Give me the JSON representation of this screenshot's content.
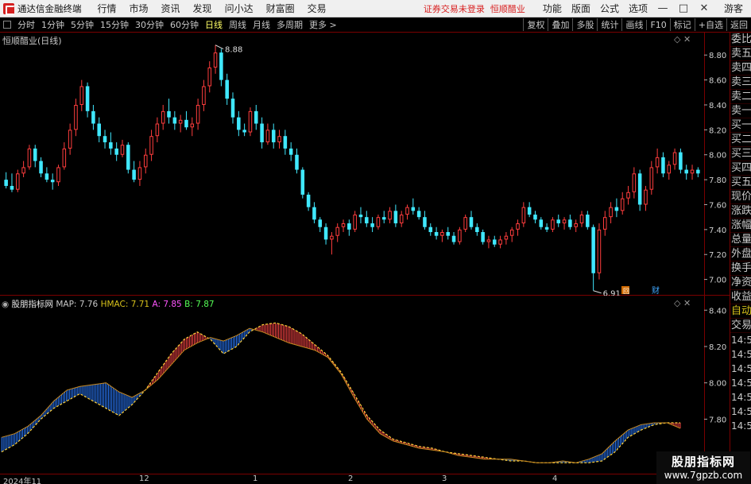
{
  "window": {
    "app_title": "通达信金融终端",
    "menu": [
      "行情",
      "市场",
      "资讯",
      "发现",
      "问小达",
      "财富圈",
      "交易"
    ],
    "notice": "证券交易未登录",
    "stock_name": "恒顺醋业",
    "right_menu": [
      "功能",
      "版面",
      "公式",
      "选项"
    ],
    "guest": "游客"
  },
  "toolbar": {
    "periods": [
      "分时",
      "1分钟",
      "5分钟",
      "15分钟",
      "30分钟",
      "60分钟",
      "日线",
      "周线",
      "月线",
      "多周期",
      "更多 >"
    ],
    "active_period": "日线",
    "tools": [
      "复权",
      "叠加",
      "多股",
      "统计",
      "画线",
      "F10",
      "标记",
      "+自选",
      "返回"
    ]
  },
  "main_panel": {
    "label": "恒顺醋业(日线)",
    "controls": "◇ ✕",
    "high_label": "8.88",
    "low_label": "6.91",
    "icon_a": "回",
    "icon_b": "财"
  },
  "indicator_panel": {
    "name": "股朋指标网",
    "map_label": "MAP:",
    "map_value": "7.76",
    "hmac_label": "HMAC:",
    "hmac_value": "7.71",
    "a_label": "A:",
    "a_value": "7.85",
    "b_label": "B:",
    "b_value": "7.87",
    "controls": "◇ ✕"
  },
  "side_panel": {
    "rows": [
      "委比",
      "卖五",
      "卖四",
      "卖三",
      "卖二",
      "卖一",
      "买一",
      "买二",
      "买三",
      "买四",
      "买五",
      "现价",
      "涨跌",
      "涨幅",
      "总量",
      "外盘",
      "换手",
      "净资",
      "收益"
    ],
    "auto_label": "自动",
    "trade_label": "交易",
    "times": [
      "14:56",
      "14:56",
      "14:56",
      "14:56",
      "14:56",
      "14:56",
      "14:56"
    ],
    "top_marker": "8"
  },
  "date_axis": {
    "labels": [
      "2024年11",
      "12",
      "1",
      "2",
      "3",
      "4"
    ]
  },
  "watermark": {
    "line1": "股朋指标网",
    "line2": "www.7gpzb.com"
  },
  "colors": {
    "up": "#ff3d3d",
    "down": "#40e8ff",
    "grid": "#7a0000",
    "axis_text": "#d0d0d0",
    "ribbon_red": "#ff4646",
    "ribbon_blue": "#2b7bff",
    "ribbon_line": "#ffd13a"
  },
  "chart_data": [
    {
      "type": "candlestick",
      "title": "恒顺醋业(日线)",
      "y_ticks": [
        7.0,
        7.2,
        7.4,
        7.6,
        7.8,
        8.0,
        8.2,
        8.4,
        8.6,
        8.8
      ],
      "ylim": [
        6.87,
        8.98
      ],
      "annotations": [
        {
          "text": "8.88",
          "value": 8.88
        },
        {
          "text": "6.91",
          "value": 6.91
        }
      ],
      "candles": [
        [
          7.8,
          7.86,
          7.73,
          7.75
        ],
        [
          7.75,
          7.85,
          7.7,
          7.72
        ],
        [
          7.72,
          7.88,
          7.7,
          7.85
        ],
        [
          7.85,
          7.95,
          7.82,
          7.9
        ],
        [
          7.9,
          8.08,
          7.88,
          8.05
        ],
        [
          8.05,
          8.08,
          7.9,
          7.95
        ],
        [
          7.95,
          7.98,
          7.82,
          7.85
        ],
        [
          7.85,
          7.9,
          7.78,
          7.8
        ],
        [
          7.8,
          7.85,
          7.72,
          7.78
        ],
        [
          7.78,
          7.92,
          7.75,
          7.9
        ],
        [
          7.9,
          8.1,
          7.88,
          8.05
        ],
        [
          8.05,
          8.25,
          8.0,
          8.2
        ],
        [
          8.2,
          8.45,
          8.15,
          8.4
        ],
        [
          8.4,
          8.6,
          8.35,
          8.55
        ],
        [
          8.55,
          8.58,
          8.3,
          8.35
        ],
        [
          8.35,
          8.4,
          8.2,
          8.25
        ],
        [
          8.25,
          8.3,
          8.1,
          8.15
        ],
        [
          8.15,
          8.2,
          8.05,
          8.1
        ],
        [
          8.1,
          8.18,
          8.0,
          8.05
        ],
        [
          8.05,
          8.1,
          7.95,
          8.0
        ],
        [
          8.0,
          8.12,
          7.98,
          8.08
        ],
        [
          8.08,
          8.1,
          7.85,
          7.88
        ],
        [
          7.88,
          7.95,
          7.78,
          7.8
        ],
        [
          7.8,
          7.95,
          7.75,
          7.9
        ],
        [
          7.9,
          8.05,
          7.85,
          8.0
        ],
        [
          8.0,
          8.2,
          7.95,
          8.15
        ],
        [
          8.15,
          8.3,
          8.1,
          8.25
        ],
        [
          8.25,
          8.4,
          8.2,
          8.35
        ],
        [
          8.35,
          8.45,
          8.25,
          8.3
        ],
        [
          8.3,
          8.35,
          8.2,
          8.25
        ],
        [
          8.25,
          8.32,
          8.18,
          8.28
        ],
        [
          8.28,
          8.35,
          8.2,
          8.22
        ],
        [
          8.22,
          8.3,
          8.15,
          8.25
        ],
        [
          8.25,
          8.45,
          8.2,
          8.4
        ],
        [
          8.4,
          8.6,
          8.35,
          8.55
        ],
        [
          8.55,
          8.75,
          8.5,
          8.7
        ],
        [
          8.7,
          8.88,
          8.65,
          8.82
        ],
        [
          8.82,
          8.85,
          8.55,
          8.6
        ],
        [
          8.6,
          8.65,
          8.4,
          8.45
        ],
        [
          8.45,
          8.5,
          8.25,
          8.3
        ],
        [
          8.3,
          8.35,
          8.15,
          8.2
        ],
        [
          8.2,
          8.25,
          8.15,
          8.18
        ],
        [
          8.18,
          8.38,
          8.15,
          8.35
        ],
        [
          8.35,
          8.4,
          8.2,
          8.25
        ],
        [
          8.25,
          8.3,
          8.05,
          8.1
        ],
        [
          8.1,
          8.25,
          8.08,
          8.2
        ],
        [
          8.2,
          8.25,
          8.05,
          8.1
        ],
        [
          8.1,
          8.2,
          8.05,
          8.15
        ],
        [
          8.15,
          8.2,
          8.0,
          8.05
        ],
        [
          8.05,
          8.1,
          7.95,
          8.0
        ],
        [
          8.0,
          8.05,
          7.85,
          7.88
        ],
        [
          7.88,
          7.9,
          7.65,
          7.68
        ],
        [
          7.68,
          7.7,
          7.55,
          7.58
        ],
        [
          7.58,
          7.62,
          7.45,
          7.48
        ],
        [
          7.48,
          7.5,
          7.38,
          7.42
        ],
        [
          7.42,
          7.45,
          7.28,
          7.32
        ],
        [
          7.32,
          7.38,
          7.2,
          7.35
        ],
        [
          7.35,
          7.45,
          7.3,
          7.42
        ],
        [
          7.42,
          7.48,
          7.38,
          7.45
        ],
        [
          7.45,
          7.48,
          7.35,
          7.4
        ],
        [
          7.4,
          7.55,
          7.38,
          7.52
        ],
        [
          7.52,
          7.58,
          7.45,
          7.5
        ],
        [
          7.5,
          7.55,
          7.42,
          7.45
        ],
        [
          7.45,
          7.5,
          7.38,
          7.42
        ],
        [
          7.42,
          7.52,
          7.4,
          7.5
        ],
        [
          7.5,
          7.55,
          7.45,
          7.48
        ],
        [
          7.48,
          7.58,
          7.45,
          7.55
        ],
        [
          7.55,
          7.6,
          7.42,
          7.45
        ],
        [
          7.45,
          7.55,
          7.42,
          7.52
        ],
        [
          7.52,
          7.6,
          7.48,
          7.58
        ],
        [
          7.58,
          7.65,
          7.52,
          7.55
        ],
        [
          7.55,
          7.58,
          7.48,
          7.5
        ],
        [
          7.5,
          7.55,
          7.4,
          7.42
        ],
        [
          7.42,
          7.45,
          7.35,
          7.38
        ],
        [
          7.38,
          7.42,
          7.32,
          7.35
        ],
        [
          7.35,
          7.4,
          7.3,
          7.38
        ],
        [
          7.38,
          7.42,
          7.32,
          7.35
        ],
        [
          7.35,
          7.38,
          7.28,
          7.3
        ],
        [
          7.3,
          7.42,
          7.28,
          7.4
        ],
        [
          7.4,
          7.52,
          7.38,
          7.5
        ],
        [
          7.5,
          7.55,
          7.4,
          7.42
        ],
        [
          7.42,
          7.45,
          7.35,
          7.38
        ],
        [
          7.38,
          7.4,
          7.28,
          7.3
        ],
        [
          7.3,
          7.35,
          7.25,
          7.32
        ],
        [
          7.32,
          7.35,
          7.26,
          7.28
        ],
        [
          7.28,
          7.35,
          7.25,
          7.32
        ],
        [
          7.32,
          7.38,
          7.28,
          7.35
        ],
        [
          7.35,
          7.42,
          7.3,
          7.4
        ],
        [
          7.4,
          7.48,
          7.35,
          7.45
        ],
        [
          7.45,
          7.62,
          7.42,
          7.58
        ],
        [
          7.58,
          7.62,
          7.5,
          7.52
        ],
        [
          7.52,
          7.55,
          7.45,
          7.48
        ],
        [
          7.48,
          7.5,
          7.4,
          7.42
        ],
        [
          7.42,
          7.45,
          7.38,
          7.4
        ],
        [
          7.4,
          7.5,
          7.38,
          7.48
        ],
        [
          7.48,
          7.52,
          7.42,
          7.45
        ],
        [
          7.45,
          7.5,
          7.4,
          7.48
        ],
        [
          7.48,
          7.52,
          7.4,
          7.42
        ],
        [
          7.42,
          7.48,
          7.38,
          7.45
        ],
        [
          7.45,
          7.55,
          7.42,
          7.52
        ],
        [
          7.52,
          7.55,
          7.4,
          7.42
        ],
        [
          7.42,
          7.44,
          6.91,
          7.05
        ],
        [
          7.05,
          7.45,
          7.0,
          7.4
        ],
        [
          7.4,
          7.55,
          7.35,
          7.5
        ],
        [
          7.5,
          7.62,
          7.45,
          7.58
        ],
        [
          7.58,
          7.65,
          7.5,
          7.55
        ],
        [
          7.55,
          7.7,
          7.52,
          7.65
        ],
        [
          7.65,
          7.75,
          7.6,
          7.7
        ],
        [
          7.7,
          7.9,
          7.65,
          7.85
        ],
        [
          7.85,
          7.88,
          7.55,
          7.6
        ],
        [
          7.6,
          7.75,
          7.55,
          7.72
        ],
        [
          7.72,
          7.95,
          7.68,
          7.9
        ],
        [
          7.9,
          8.05,
          7.85,
          7.98
        ],
        [
          7.98,
          8.02,
          7.82,
          7.85
        ],
        [
          7.85,
          7.95,
          7.8,
          7.92
        ],
        [
          7.92,
          8.05,
          7.88,
          8.02
        ],
        [
          8.02,
          8.05,
          7.85,
          7.88
        ],
        [
          7.88,
          7.92,
          7.8,
          7.85
        ],
        [
          7.85,
          7.92,
          7.8,
          7.88
        ],
        [
          7.88,
          7.9,
          7.82,
          7.85
        ]
      ]
    },
    {
      "type": "area",
      "title": "股朋指标网",
      "y_ticks": [
        7.6,
        7.8,
        8.0,
        8.2,
        8.4
      ],
      "ylim": [
        7.5,
        8.48
      ],
      "series": [
        {
          "name": "MAP",
          "values": [
            7.7,
            7.72,
            7.76,
            7.82,
            7.9,
            7.96,
            7.98,
            7.99,
            8.0,
            7.95,
            7.92,
            7.96,
            8.02,
            8.1,
            8.18,
            8.22,
            8.25,
            8.23,
            8.26,
            8.3,
            8.28,
            8.25,
            8.22,
            8.2,
            8.18,
            8.14,
            8.05,
            7.92,
            7.8,
            7.72,
            7.68,
            7.66,
            7.64,
            7.63,
            7.62,
            7.6,
            7.59,
            7.58,
            7.58,
            7.58,
            7.57,
            7.56,
            7.56,
            7.57,
            7.56,
            7.58,
            7.61,
            7.68,
            7.74,
            7.77,
            7.78,
            7.78,
            7.75
          ]
        },
        {
          "name": "HMAC",
          "values": [
            7.62,
            7.66,
            7.72,
            7.8,
            7.86,
            7.9,
            7.94,
            7.9,
            7.86,
            7.82,
            7.88,
            7.96,
            8.06,
            8.16,
            8.24,
            8.28,
            8.24,
            8.16,
            8.2,
            8.28,
            8.32,
            8.33,
            8.31,
            8.27,
            8.21,
            8.15,
            8.06,
            7.94,
            7.82,
            7.74,
            7.69,
            7.67,
            7.65,
            7.64,
            7.62,
            7.61,
            7.6,
            7.59,
            7.58,
            7.57,
            7.57,
            7.56,
            7.56,
            7.56,
            7.56,
            7.56,
            7.57,
            7.62,
            7.7,
            7.74,
            7.77,
            7.78,
            7.78
          ]
        },
        {
          "name": "A",
          "value": 7.85
        },
        {
          "name": "B",
          "value": 7.87
        }
      ]
    }
  ]
}
